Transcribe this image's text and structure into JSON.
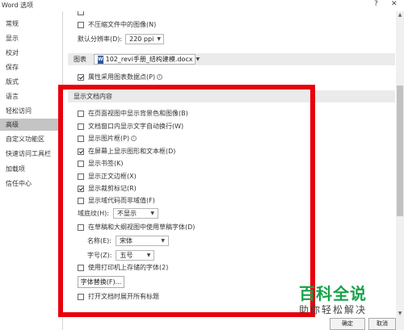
{
  "window": {
    "title": "Word 选项",
    "help": "?",
    "close": "✕"
  },
  "sidebar": {
    "items": [
      {
        "label": "常规"
      },
      {
        "label": "显示"
      },
      {
        "label": "校对"
      },
      {
        "label": "保存"
      },
      {
        "label": "版式"
      },
      {
        "label": "语言"
      },
      {
        "label": "轻松访问"
      },
      {
        "label": "高级",
        "active": true
      },
      {
        "label": "自定义功能区"
      },
      {
        "label": "快速访问工具栏"
      },
      {
        "label": "加载项"
      },
      {
        "label": "信任中心"
      }
    ]
  },
  "image_options": {
    "no_compress_label": "不压缩文件中的图像(N)",
    "no_compress_checked": false,
    "default_resolution_label": "默认分辨率(D):",
    "default_resolution_value": "220 ppi"
  },
  "chart": {
    "header": "图表",
    "document_value": "102_revi手册_结构建模.docx",
    "doc_icon": "W",
    "property_label": "属性采用图表数据点(P)",
    "property_checked": true
  },
  "document_content": {
    "header": "显示文档内容",
    "options": [
      {
        "label": "在页面视图中显示背景色和图像(B)",
        "checked": false,
        "info": false
      },
      {
        "label": "文档窗口内显示文字自动换行(W)",
        "checked": false,
        "info": false
      },
      {
        "label": "显示图片框(P)",
        "checked": false,
        "info": true
      },
      {
        "label": "在屏幕上显示图形和文本框(D)",
        "checked": true,
        "info": false
      },
      {
        "label": "显示书签(K)",
        "checked": false,
        "info": false
      },
      {
        "label": "显示正文边框(X)",
        "checked": false,
        "info": false
      },
      {
        "label": "显示裁剪标记(R)",
        "checked": true,
        "info": false
      },
      {
        "label": "显示域代码而非域值(F)",
        "checked": false,
        "info": false
      }
    ],
    "field_shading_label": "域底纹(H):",
    "field_shading_value": "不显示",
    "draft_font_label": "在草稿和大纲视图中使用草稿字体(D)",
    "draft_font_checked": false,
    "font_name_label": "名称(E):",
    "font_name_value": "宋体",
    "font_size_label": "字号(Z):",
    "font_size_value": "五号",
    "printer_fonts_label": "使用打印机上存储的字体(2)",
    "printer_fonts_checked": false,
    "font_substitution_button": "字体替换(F)...",
    "expand_headings_label": "打开文档时展开所有标题",
    "expand_headings_checked": false
  },
  "footer": {
    "ok": "确定",
    "cancel": "取消"
  },
  "watermark": {
    "title": "百科全说",
    "subtitle": "助你轻松解决"
  },
  "colors": {
    "highlight": "#e8000b",
    "active_nav": "#c4c4c4",
    "watermark": "#16a34a"
  }
}
